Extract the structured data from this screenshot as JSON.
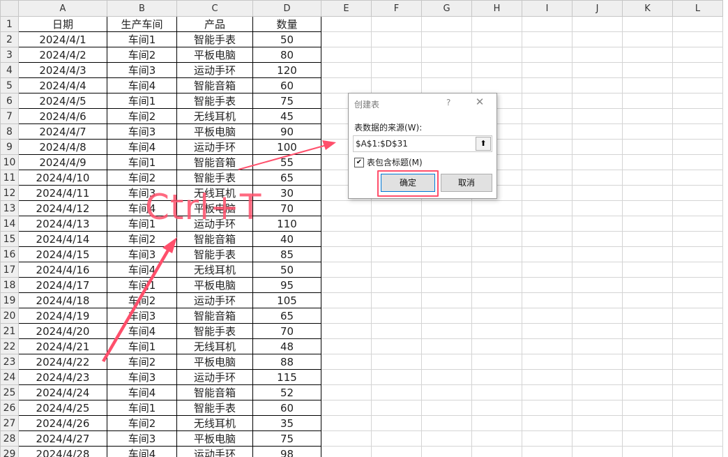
{
  "sheet": {
    "col_headers": [
      "A",
      "B",
      "C",
      "D",
      "E",
      "F",
      "G",
      "H",
      "I",
      "J",
      "K",
      "L"
    ],
    "row_numbers": [
      "1",
      "2",
      "3",
      "4",
      "5",
      "6",
      "7",
      "8",
      "9",
      "10",
      "11",
      "12",
      "13",
      "14",
      "15",
      "16",
      "17",
      "18",
      "19",
      "20",
      "21",
      "22",
      "23",
      "24",
      "25",
      "26",
      "27",
      "28",
      "29"
    ],
    "rows": [
      [
        "日期",
        "生产车间",
        "产品",
        "数量"
      ],
      [
        "2024/4/1",
        "车间1",
        "智能手表",
        "50"
      ],
      [
        "2024/4/2",
        "车间2",
        "平板电脑",
        "80"
      ],
      [
        "2024/4/3",
        "车间3",
        "运动手环",
        "120"
      ],
      [
        "2024/4/4",
        "车间4",
        "智能音箱",
        "60"
      ],
      [
        "2024/4/5",
        "车间1",
        "智能手表",
        "75"
      ],
      [
        "2024/4/6",
        "车间2",
        "无线耳机",
        "45"
      ],
      [
        "2024/4/7",
        "车间3",
        "平板电脑",
        "90"
      ],
      [
        "2024/4/8",
        "车间4",
        "运动手环",
        "100"
      ],
      [
        "2024/4/9",
        "车间1",
        "智能音箱",
        "55"
      ],
      [
        "2024/4/10",
        "车间2",
        "智能手表",
        "65"
      ],
      [
        "2024/4/11",
        "车间3",
        "无线耳机",
        "30"
      ],
      [
        "2024/4/12",
        "车间4",
        "平板电脑",
        "70"
      ],
      [
        "2024/4/13",
        "车间1",
        "运动手环",
        "110"
      ],
      [
        "2024/4/14",
        "车间2",
        "智能音箱",
        "40"
      ],
      [
        "2024/4/15",
        "车间3",
        "智能手表",
        "85"
      ],
      [
        "2024/4/16",
        "车间4",
        "无线耳机",
        "50"
      ],
      [
        "2024/4/17",
        "车间1",
        "平板电脑",
        "95"
      ],
      [
        "2024/4/18",
        "车间2",
        "运动手环",
        "105"
      ],
      [
        "2024/4/19",
        "车间3",
        "智能音箱",
        "65"
      ],
      [
        "2024/4/20",
        "车间4",
        "智能手表",
        "70"
      ],
      [
        "2024/4/21",
        "车间1",
        "无线耳机",
        "48"
      ],
      [
        "2024/4/22",
        "车间2",
        "平板电脑",
        "88"
      ],
      [
        "2024/4/23",
        "车间3",
        "运动手环",
        "115"
      ],
      [
        "2024/4/24",
        "车间4",
        "智能音箱",
        "52"
      ],
      [
        "2024/4/25",
        "车间1",
        "智能手表",
        "60"
      ],
      [
        "2024/4/26",
        "车间2",
        "无线耳机",
        "35"
      ],
      [
        "2024/4/27",
        "车间3",
        "平板电脑",
        "75"
      ],
      [
        "2024/4/28",
        "车间4",
        "运动手环",
        "98"
      ]
    ]
  },
  "overlay": {
    "shortcut_text": "Ctrl+T",
    "accent_color": "#ff4f6b"
  },
  "dialog": {
    "title": "创建表",
    "help": "?",
    "close_icon": "close-icon",
    "source_label": "表数据的来源(W):",
    "range_value": "$A$1:$D$31",
    "collapse_icon": "upload-arrow-icon",
    "has_headers_label": "表包含标题(M)",
    "has_headers_checked": true,
    "ok_label": "确定",
    "cancel_label": "取消"
  }
}
